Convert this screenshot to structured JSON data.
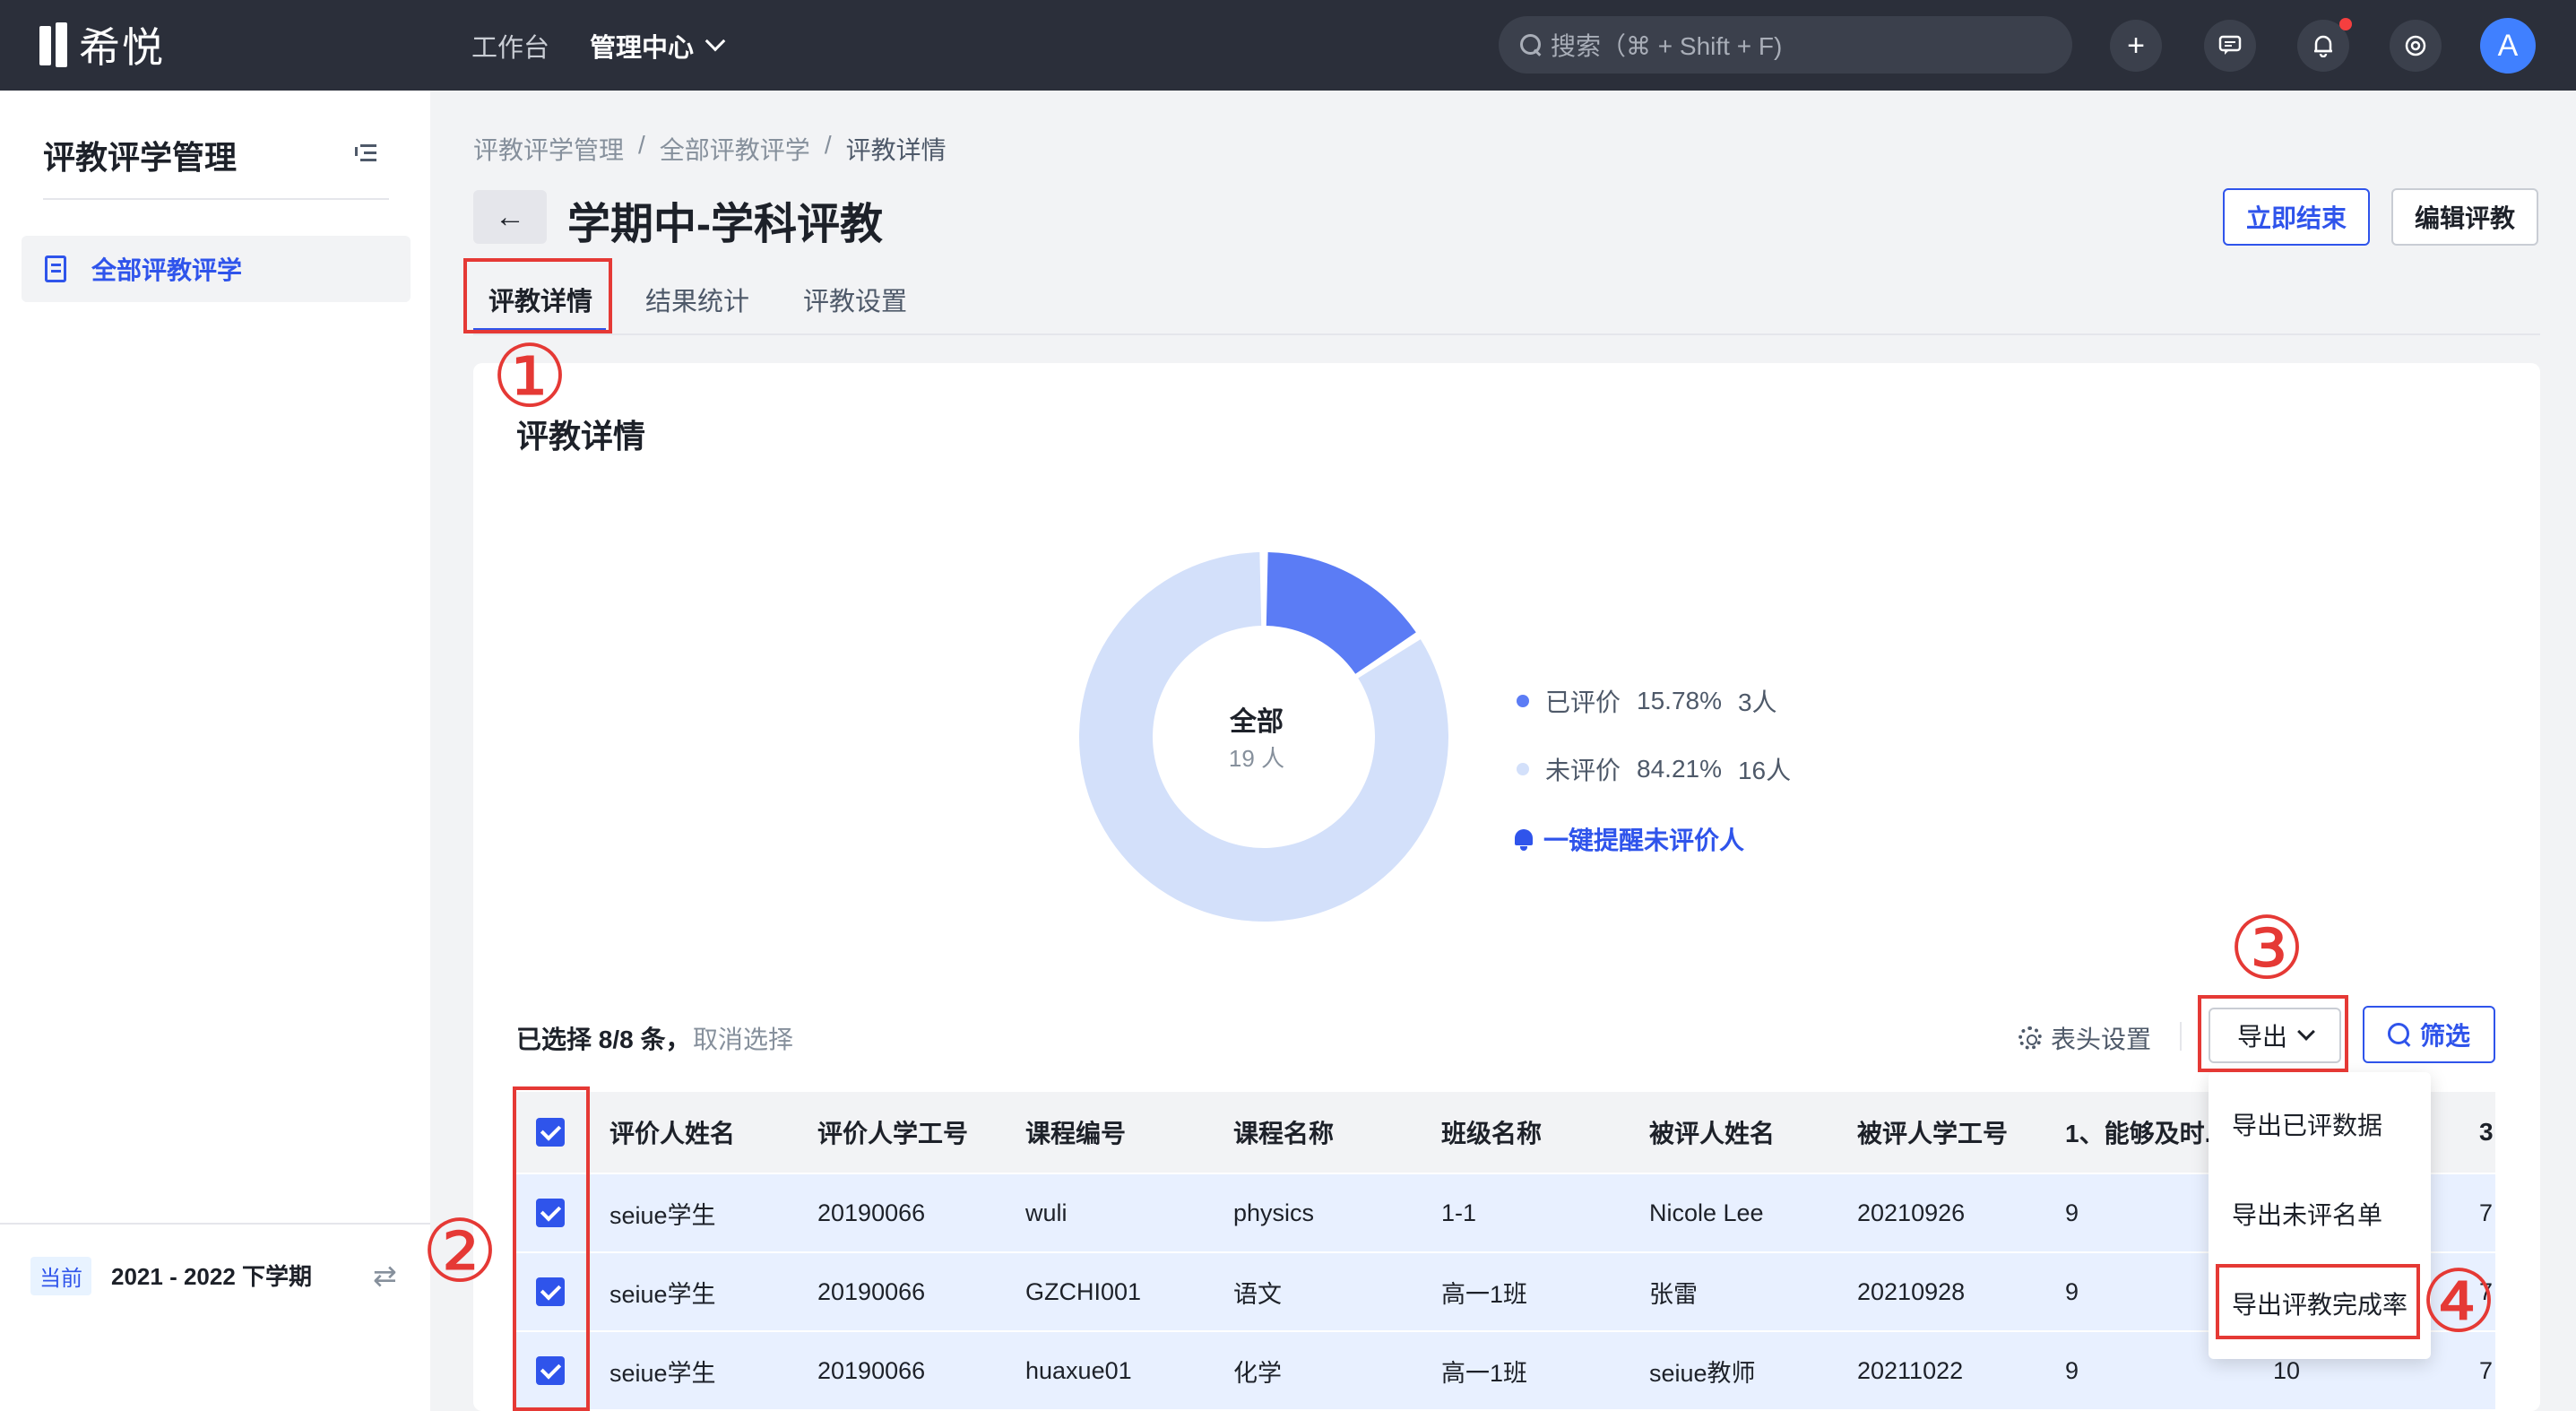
{
  "app": {
    "logo_text": "希悦"
  },
  "topnav": {
    "items": [
      "工作台",
      "管理中心"
    ],
    "search_placeholder": "搜索（⌘ + Shift + F)",
    "avatar_letter": "A"
  },
  "sidebar": {
    "title": "评教评学管理",
    "items": [
      {
        "label": "全部评教评学"
      }
    ],
    "term_badge": "当前",
    "term_text": "2021 - 2022 下学期"
  },
  "breadcrumb": [
    "评教评学管理",
    "/",
    "全部评教评学",
    "/",
    "评教详情"
  ],
  "page": {
    "title": "学期中-学科评教",
    "end_button": "立即结束",
    "edit_button": "编辑评教"
  },
  "tabs": [
    "评教详情",
    "结果统计",
    "评教设置"
  ],
  "card": {
    "title": "评教详情",
    "donut_center_label": "全部",
    "donut_center_sub": "19 人",
    "legend": [
      {
        "label": "已评价",
        "percent": "15.78%",
        "count": "3人",
        "color": "#5b7cf5"
      },
      {
        "label": "未评价",
        "percent": "84.21%",
        "count": "16人",
        "color": "#d3e0fa"
      }
    ],
    "remind_link": "一键提醒未评价人"
  },
  "chart_data": {
    "type": "pie",
    "categories": [
      "已评价",
      "未评价"
    ],
    "values": [
      15.78,
      84.21
    ]
  },
  "toolbar": {
    "selected_text": "已选择 8/8 条，",
    "cancel_select": "取消选择",
    "column_settings": "表头设置",
    "export_label": "导出",
    "filter_label": "筛选"
  },
  "export_menu": [
    "导出已评数据",
    "导出未评名单",
    "导出评教完成率"
  ],
  "table": {
    "headers": [
      "评价人姓名",
      "评价人学工号",
      "课程编号",
      "课程名称",
      "班级名称",
      "被评人姓名",
      "被评人学工号",
      "1、能够及时...",
      "3"
    ],
    "rows": [
      [
        "seiue学生",
        "20190066",
        "wuli",
        "physics",
        "1-1",
        "Nicole Lee",
        "20210926",
        "9",
        "",
        "7"
      ],
      [
        "seiue学生",
        "20190066",
        "GZCHI001",
        "语文",
        "高一1班",
        "张雷",
        "20210928",
        "9",
        "",
        "7"
      ],
      [
        "seiue学生",
        "20190066",
        "huaxue01",
        "化学",
        "高一1班",
        "seiue教师",
        "20211022",
        "9",
        "10",
        "7"
      ]
    ]
  },
  "annotations": [
    "①",
    "②",
    "③",
    "④"
  ]
}
